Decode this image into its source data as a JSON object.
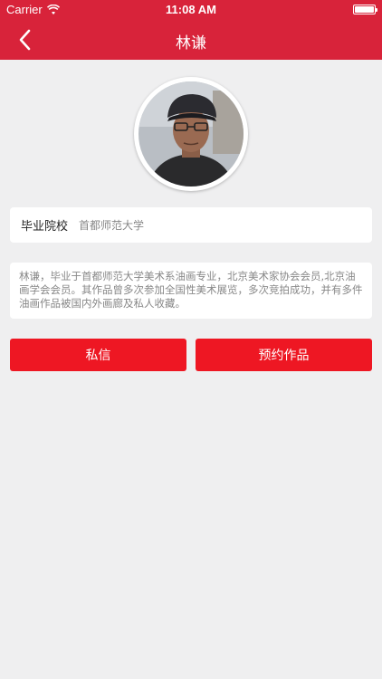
{
  "status_bar": {
    "carrier": "Carrier",
    "time": "11:08 AM"
  },
  "nav": {
    "title": "林谦",
    "back_icon": "chevron-left-icon"
  },
  "profile": {
    "school_label": "毕业院校",
    "school_value": "首都师范大学",
    "bio": "林谦，毕业于首都师范大学美术系油画专业，北京美术家协会会员,北京油画学会会员。其作品曾多次参加全国性美术展览，多次竞拍成功，并有多件油画作品被国内外画廊及私人收藏。"
  },
  "actions": {
    "message_label": "私信",
    "book_label": "预约作品"
  },
  "colors": {
    "header": "#d8233a",
    "button": "#ee1723",
    "background": "#efeff0"
  }
}
